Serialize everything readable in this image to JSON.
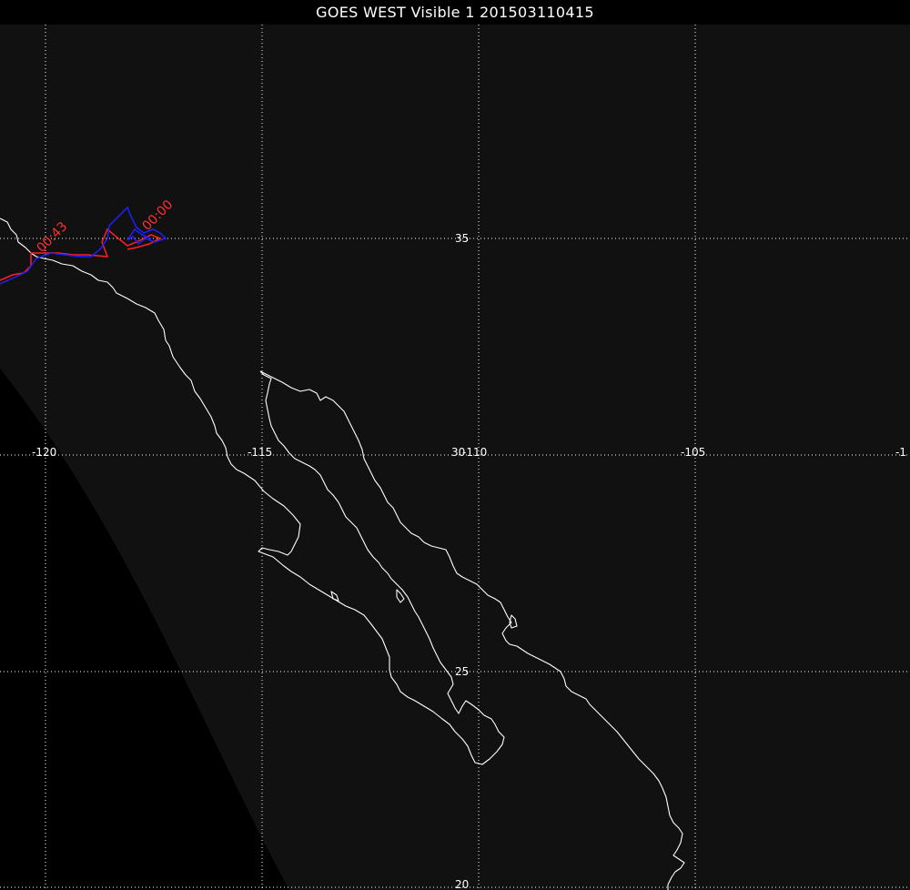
{
  "title": "GOES WEST Visible 1 201503110415",
  "colors": {
    "background": "#000000",
    "earth_disk": "#111111",
    "grid": "#ffffff",
    "coastline": "#ffffff",
    "track_red": "#ff2020",
    "track_blue": "#2020ff"
  },
  "grid_labels": {
    "lon_120": "-120",
    "lon_115": "-115",
    "lon_110": "-110",
    "lon_105": "-105",
    "lon_100": "-1",
    "lat_35": "35",
    "lat_30": "30",
    "lat_25": "25",
    "lat_20": "20"
  },
  "track_labels": {
    "red_label": "00:43",
    "red_label_2": "00:00",
    "blue_label": "00:00"
  }
}
